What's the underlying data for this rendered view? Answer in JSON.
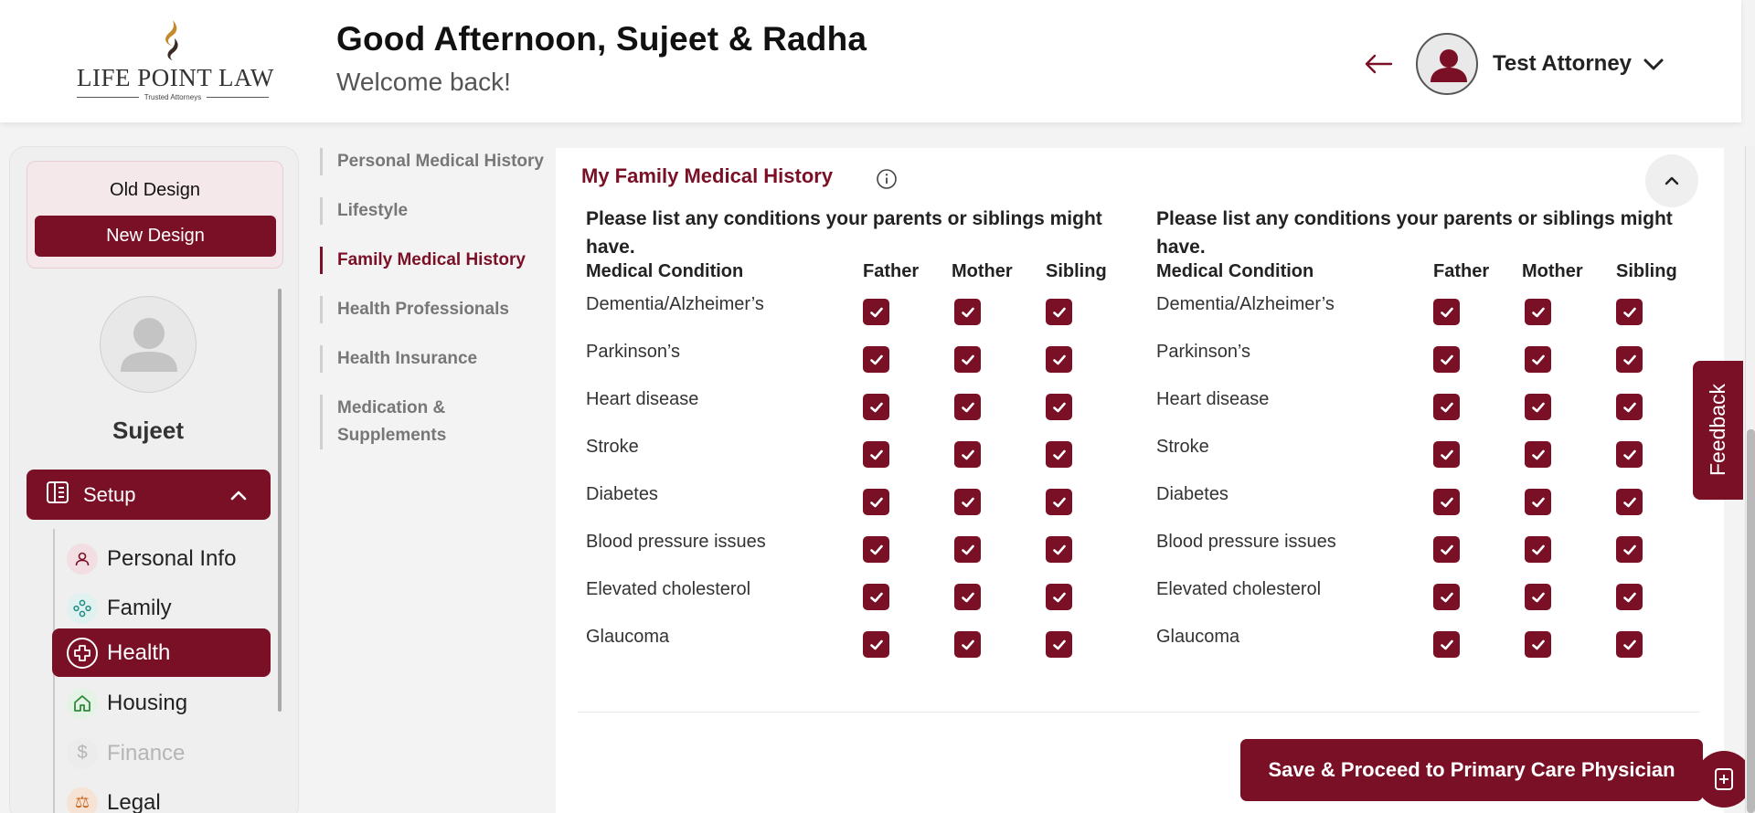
{
  "brand": {
    "name": "LIFE POINT LAW",
    "tagline": "Trusted Attorneys",
    "accent_color": "#7a1026"
  },
  "header": {
    "greeting": "Good Afternoon, Sujeet & Radha",
    "subtitle": "Welcome back!",
    "user_name": "Test Attorney",
    "back_icon": "left-arrow-icon",
    "user_menu_icon": "chevron-down-icon"
  },
  "sidebar": {
    "old_design": "Old Design",
    "new_design": "New Design",
    "profile_name": "Sujeet",
    "setup_label": "Setup",
    "items": [
      {
        "label": "Personal Info",
        "icon": "person-icon",
        "state": "normal"
      },
      {
        "label": "Family",
        "icon": "family-icon",
        "state": "normal"
      },
      {
        "label": "Health",
        "icon": "health-plus-icon",
        "state": "active"
      },
      {
        "label": "Housing",
        "icon": "house-icon",
        "state": "normal"
      },
      {
        "label": "Finance",
        "icon": "dollar-icon",
        "state": "disabled"
      },
      {
        "label": "Legal",
        "icon": "legal-icon",
        "state": "normal"
      }
    ]
  },
  "subnav": {
    "items": [
      {
        "label": "Personal Medical History",
        "active": false
      },
      {
        "label": "Lifestyle",
        "active": false
      },
      {
        "label": "Family Medical History",
        "active": true
      },
      {
        "label": "Health Professionals",
        "active": false
      },
      {
        "label": "Health Insurance",
        "active": false
      },
      {
        "label": "Medication & Supplements",
        "active": false
      }
    ]
  },
  "panel": {
    "title": "My Family Medical History",
    "prompt": "Please list any conditions your parents or siblings might have.",
    "columns": {
      "condition": "Medical Condition",
      "father": "Father",
      "mother": "Mother",
      "sibling": "Sibling"
    },
    "left_rows": [
      {
        "condition": "Dementia/Alzheimer’s",
        "father": true,
        "mother": true,
        "sibling": true
      },
      {
        "condition": "Parkinson’s",
        "father": true,
        "mother": true,
        "sibling": true
      },
      {
        "condition": "Heart disease",
        "father": true,
        "mother": true,
        "sibling": true
      },
      {
        "condition": "Stroke",
        "father": true,
        "mother": true,
        "sibling": true
      },
      {
        "condition": "Diabetes",
        "father": true,
        "mother": true,
        "sibling": true
      },
      {
        "condition": "Blood pressure issues",
        "father": true,
        "mother": true,
        "sibling": true
      },
      {
        "condition": "Elevated cholesterol",
        "father": true,
        "mother": true,
        "sibling": true
      },
      {
        "condition": "Glaucoma",
        "father": true,
        "mother": true,
        "sibling": true
      }
    ],
    "right_rows": [
      {
        "condition": "Dementia/Alzheimer’s",
        "father": true,
        "mother": true,
        "sibling": true
      },
      {
        "condition": "Parkinson’s",
        "father": true,
        "mother": true,
        "sibling": true
      },
      {
        "condition": "Heart disease",
        "father": true,
        "mother": true,
        "sibling": true
      },
      {
        "condition": "Stroke",
        "father": true,
        "mother": true,
        "sibling": true
      },
      {
        "condition": "Diabetes",
        "father": true,
        "mother": true,
        "sibling": true
      },
      {
        "condition": "Blood pressure issues",
        "father": true,
        "mother": true,
        "sibling": true
      },
      {
        "condition": "Elevated cholesterol",
        "father": true,
        "mother": true,
        "sibling": true
      },
      {
        "condition": "Glaucoma",
        "father": true,
        "mother": true,
        "sibling": true
      }
    ],
    "save_button": "Save & Proceed to Primary Care Physician"
  },
  "feedback": {
    "label": "Feedback"
  }
}
